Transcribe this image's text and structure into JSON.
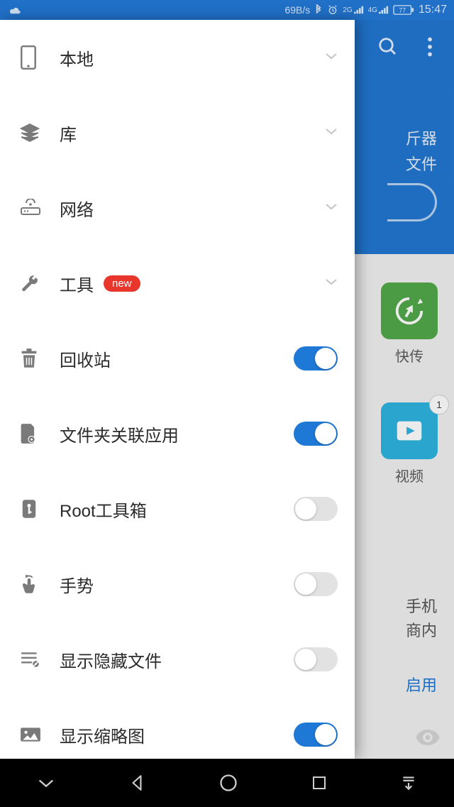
{
  "statusbar": {
    "speed": "69B/s",
    "battery": "77",
    "time": "15:47"
  },
  "drawer": {
    "items": [
      {
        "label": "本地",
        "type": "expand"
      },
      {
        "label": "库",
        "type": "expand"
      },
      {
        "label": "网络",
        "type": "expand"
      },
      {
        "label": "工具",
        "type": "expand",
        "badge": "new"
      },
      {
        "label": "回收站",
        "type": "toggle",
        "on": true
      },
      {
        "label": "文件夹关联应用",
        "type": "toggle",
        "on": true
      },
      {
        "label": "Root工具箱",
        "type": "toggle",
        "on": false
      },
      {
        "label": "手势",
        "type": "toggle",
        "on": false
      },
      {
        "label": "显示隐藏文件",
        "type": "toggle",
        "on": false
      },
      {
        "label": "显示缩略图",
        "type": "toggle",
        "on": true
      }
    ]
  },
  "background": {
    "header_line1": "斤器",
    "header_line2": "文件",
    "tile1": {
      "label": "快传"
    },
    "tile2": {
      "label": "视频",
      "badge": "1"
    },
    "promo_line1": "手机",
    "promo_line2": "商内",
    "enable": "启用"
  }
}
